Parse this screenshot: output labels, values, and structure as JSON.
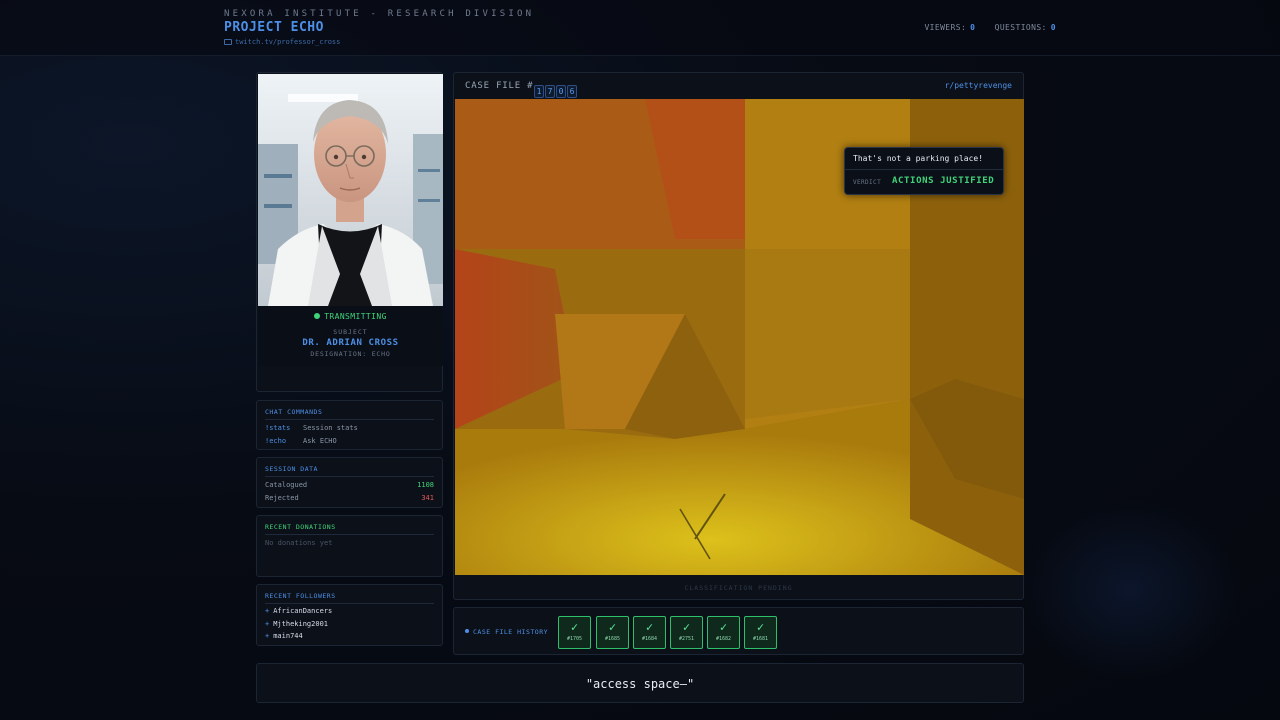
{
  "header": {
    "org": "NEXORA INSTITUTE - RESEARCH DIVISION",
    "project": "PROJECT ECHO",
    "link": "twitch.tv/professor_cross",
    "viewers_label": "VIEWERS:",
    "viewers_value": "0",
    "questions_label": "QUESTIONS:",
    "questions_value": "0"
  },
  "subject": {
    "status": "TRANSMITTING",
    "label": "SUBJECT",
    "name": "DR. ADRIAN CROSS",
    "designation": "DESIGNATION: ECHO"
  },
  "chat_commands": {
    "title": "CHAT COMMANDS",
    "items": [
      {
        "cmd": "!stats",
        "desc": "Session stats"
      },
      {
        "cmd": "!echo",
        "desc": "Ask ECHO"
      }
    ]
  },
  "session_data": {
    "title": "SESSION DATA",
    "catalogued_label": "Catalogued",
    "catalogued_value": "1108",
    "rejected_label": "Rejected",
    "rejected_value": "341"
  },
  "donations": {
    "title": "RECENT DONATIONS",
    "empty": "No donations yet"
  },
  "followers": {
    "title": "RECENT FOLLOWERS",
    "items": [
      "AfricanDancers",
      "Mjtheking2001",
      "main744"
    ]
  },
  "case": {
    "label": "CASE FILE #",
    "digits": [
      "1",
      "7",
      "0",
      "6"
    ],
    "subreddit": "r/pettyrevenge",
    "quote": "That's not a parking place!",
    "verdict_label": "VERDICT",
    "verdict_value": "ACTIONS JUSTIFIED",
    "pending": "CLASSIFICATION PENDING"
  },
  "history": {
    "label": "CASE FILE HISTORY",
    "items": [
      {
        "check": "✓",
        "num": "#1705"
      },
      {
        "check": "✓",
        "num": "#1685"
      },
      {
        "check": "✓",
        "num": "#1684"
      },
      {
        "check": "✓",
        "num": "#2751"
      },
      {
        "check": "✓",
        "num": "#1682"
      },
      {
        "check": "✓",
        "num": "#1681"
      }
    ]
  },
  "speech": {
    "text": "\"access space—\""
  },
  "colors": {
    "accent": "#4d8fe6",
    "success": "#3fd47a",
    "danger": "#e05858"
  }
}
